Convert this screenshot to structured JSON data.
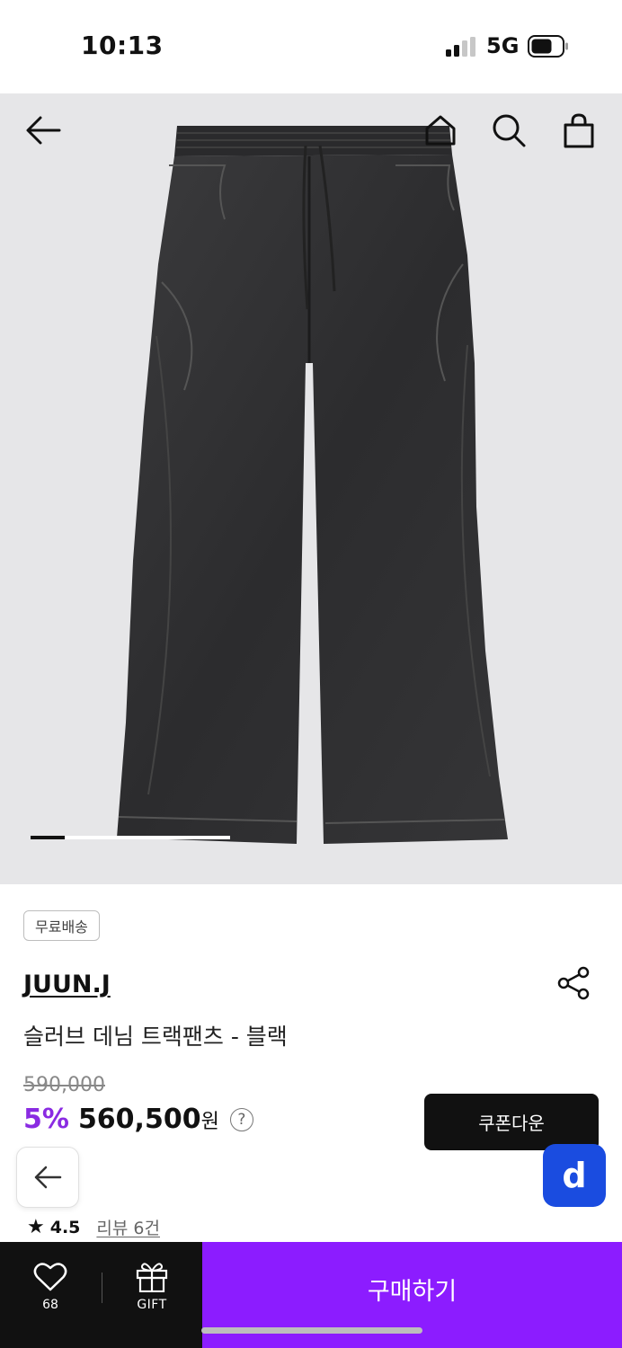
{
  "status_bar": {
    "time": "10:13",
    "network": "5G",
    "icons": [
      "signal-icon",
      "battery-icon"
    ]
  },
  "hero": {
    "image_icon": "denim-pants-photo",
    "nav_icons": [
      "back-arrow-icon",
      "home-icon",
      "search-icon",
      "shopping-bag-icon"
    ],
    "gallery_progress": 0.17
  },
  "product": {
    "badge": "무료배송",
    "brand": "JUUN.J",
    "title": "슬러브 데님 트랙팬츠 - 블랙",
    "original_price": "590,000",
    "discount": "5%",
    "price": "560,500",
    "currency": "원",
    "help_symbol": "?",
    "coupon_label": "쿠폰다운"
  },
  "floating": {
    "back_icon": "back-arrow-icon",
    "d_label": "d"
  },
  "rating": {
    "star": "★",
    "value": "4.5",
    "review_label": "리뷰 6건"
  },
  "bottom_bar": {
    "like_count": "68",
    "gift_label": "GIFT",
    "buy_label": "구매하기"
  },
  "colors": {
    "accent_purple": "#8c1cff",
    "discount_purple": "#8a2be2",
    "dark": "#111111",
    "app_blue": "#1a4ce0",
    "hero_bg": "#e6e6e8"
  }
}
